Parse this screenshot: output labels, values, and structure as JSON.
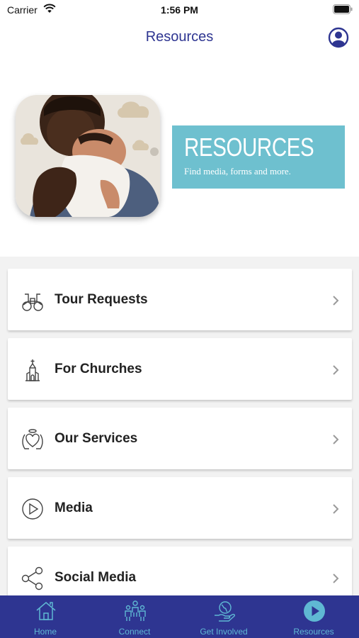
{
  "status_bar": {
    "carrier": "Carrier",
    "time": "1:56 PM"
  },
  "nav": {
    "title": "Resources"
  },
  "hero": {
    "banner_title": "RESOURCES",
    "banner_subtitle": "Find media, forms and more."
  },
  "list": {
    "items": [
      {
        "label": "Tour Requests",
        "icon": "binoculars-icon"
      },
      {
        "label": "For Churches",
        "icon": "church-icon"
      },
      {
        "label": "Our Services",
        "icon": "angel-heart-icon"
      },
      {
        "label": "Media",
        "icon": "play-circle-icon"
      },
      {
        "label": "Social Media",
        "icon": "share-icon"
      }
    ]
  },
  "tabs": [
    {
      "label": "Home",
      "icon": "home-icon"
    },
    {
      "label": "Connect",
      "icon": "people-icon"
    },
    {
      "label": "Get Involved",
      "icon": "hand-globe-icon"
    },
    {
      "label": "Resources",
      "icon": "play-circle-icon",
      "active": true
    }
  ],
  "colors": {
    "brand": "#2e3591",
    "accent": "#6ec0cf",
    "tab_label": "#5fb8d3"
  }
}
